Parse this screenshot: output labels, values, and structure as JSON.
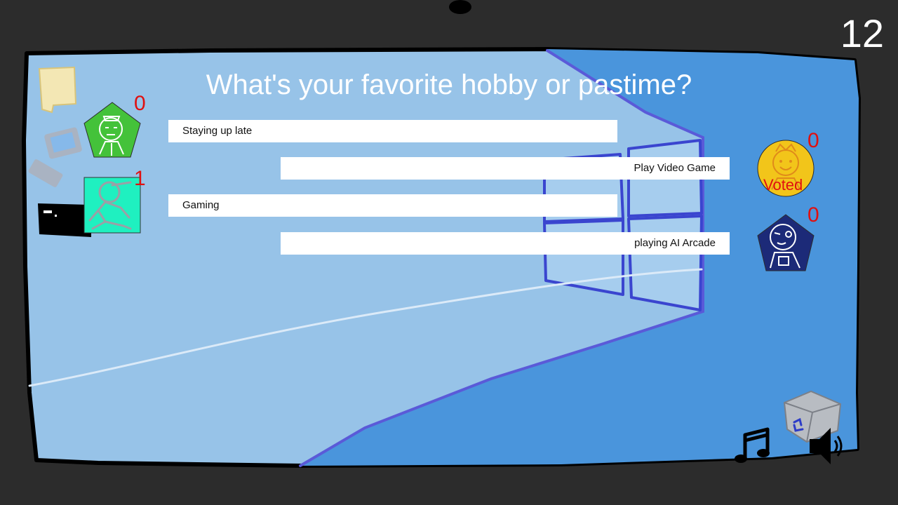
{
  "timer": "12",
  "question": "What's your favorite hobby or pastime?",
  "answers": [
    "Staying up late",
    "Play Video Game",
    "Gaming",
    "playing AI Arcade"
  ],
  "players": [
    {
      "score": "0",
      "avatar": "green-pentagon-avatar",
      "color": "#44c23a"
    },
    {
      "score": "1",
      "avatar": "teal-square-avatar",
      "color": "#1ff0c0"
    },
    {
      "score": "0",
      "avatar": "yellow-circle-avatar",
      "color": "#f2c51a",
      "status": "Voted"
    },
    {
      "score": "0",
      "avatar": "navy-pentagon-avatar",
      "color": "#1c2a78"
    }
  ],
  "colors": {
    "background": "#2c2c2c",
    "wall_light": "#97c3e8",
    "wall_dark": "#4a95dc",
    "line": "#4a55d0",
    "score": "#e01010"
  },
  "icons": {
    "music": "music-note-icon",
    "sound": "speaker-icon",
    "recycle": "recycle-bin-icon"
  }
}
